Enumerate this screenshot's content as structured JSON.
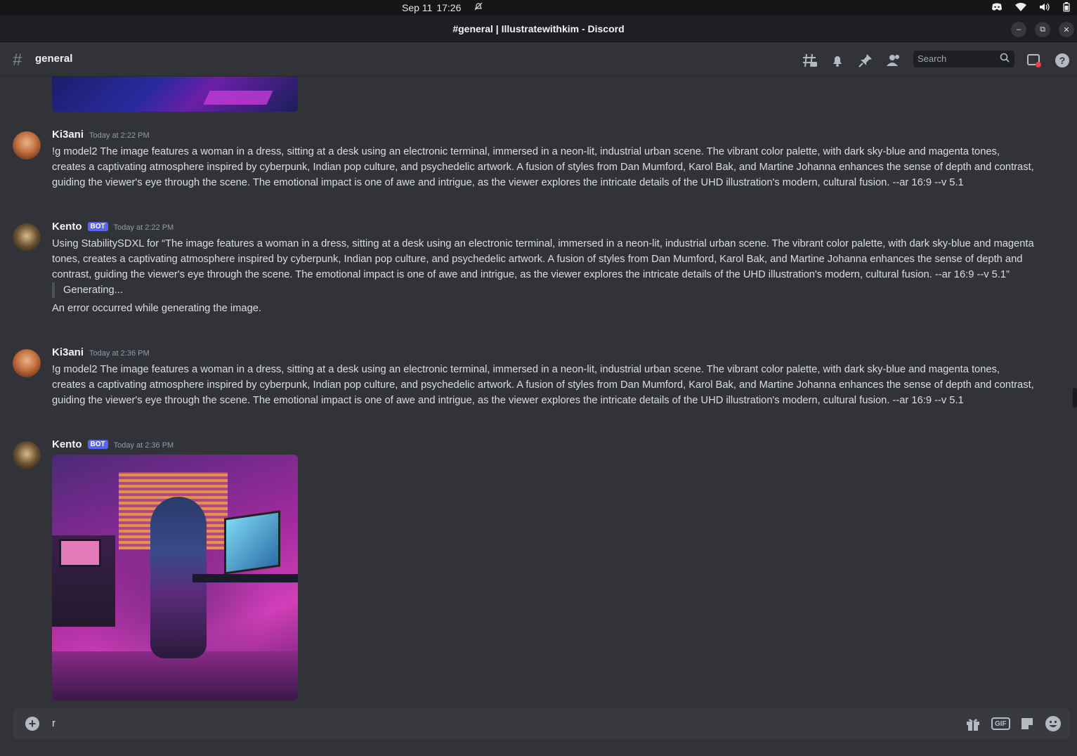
{
  "os": {
    "date": "Sep 11",
    "time": "17:26"
  },
  "window": {
    "title": "#general | Illustratewithkim - Discord"
  },
  "channel": {
    "name": "general",
    "search_placeholder": "Search"
  },
  "messages": [
    {
      "author": "Ki3ani",
      "timestamp": "Today at 2:22 PM",
      "text": "!g model2 The image features a woman in a dress, sitting at a desk using an electronic terminal, immersed in a neon-lit, industrial urban scene. The vibrant color palette, with dark sky-blue and magenta tones, creates a captivating atmosphere inspired by cyberpunk, Indian pop culture, and psychedelic artwork. A fusion of styles from Dan Mumford, Karol Bak, and Martine Johanna enhances the sense of depth and contrast, guiding the viewer's eye through the scene. The emotional impact is one of awe and intrigue, as the viewer explores the intricate details of the UHD illustration's modern, cultural fusion. --ar 16:9 --v 5.1"
    },
    {
      "author": "Kento",
      "bot_tag": "BOT",
      "timestamp": "Today at 2:22 PM",
      "text": "Using StabilitySDXL for “The image features a woman in a dress, sitting at a desk using an electronic terminal, immersed in a neon-lit, industrial urban scene. The vibrant color palette, with dark sky-blue and magenta tones, creates a captivating atmosphere inspired by cyberpunk, Indian pop culture, and psychedelic artwork. A fusion of styles from Dan Mumford, Karol Bak, and Martine Johanna enhances the sense of depth and contrast, guiding the viewer's eye through the scene. The emotional impact is one of awe and intrigue, as the viewer explores the intricate details of the UHD illustration's modern, cultural fusion. --ar 16:9 --v 5.1”",
      "quote": "Generating...",
      "error": "An error occurred while generating the image."
    },
    {
      "author": "Ki3ani",
      "timestamp": "Today at 2:36 PM",
      "text": "!g model2 The image features a woman in a dress, sitting at a desk using an electronic terminal, immersed in a neon-lit, industrial urban scene. The vibrant color palette, with dark sky-blue and magenta tones, creates a captivating atmosphere inspired by cyberpunk, Indian pop culture, and psychedelic artwork. A fusion of styles from Dan Mumford, Karol Bak, and Martine Johanna enhances the sense of depth and contrast, guiding the viewer's eye through the scene. The emotional impact is one of awe and intrigue, as the viewer explores the intricate details of the UHD illustration's modern, cultural fusion. --ar 16:9 --v 5.1"
    },
    {
      "author": "Kento",
      "bot_tag": "BOT",
      "timestamp": "Today at 2:36 PM"
    }
  ],
  "composer": {
    "value": "r",
    "gif_label": "GIF"
  },
  "colors": {
    "background": "#313338",
    "bot_tag": "#5865f2",
    "composer": "#383a40"
  }
}
